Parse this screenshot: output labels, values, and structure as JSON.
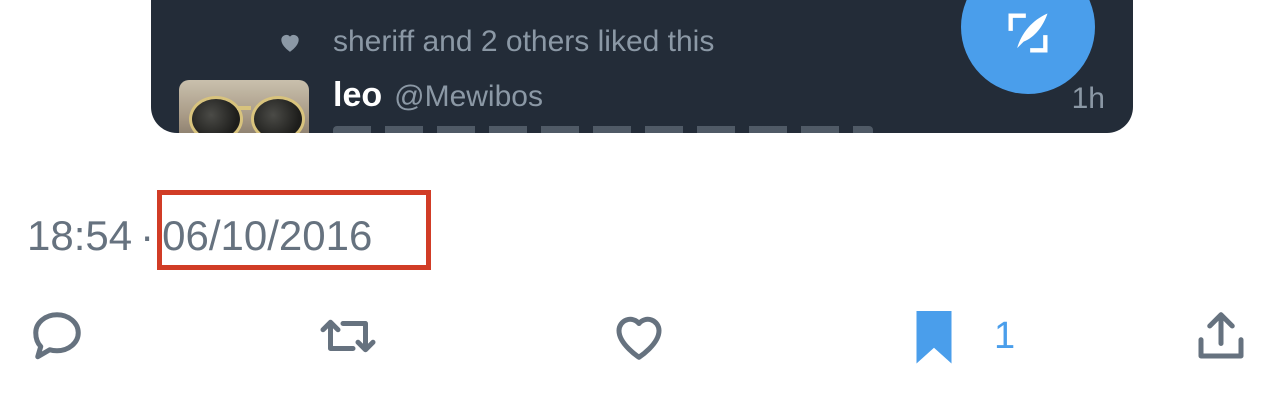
{
  "embedded_tweet": {
    "liked_by_text": "sheriff and 2 others liked this",
    "author_name": "leo",
    "author_handle": "@Mewibos",
    "time_ago": "1h",
    "avatar_icon": "sunglasses-avatar",
    "compose_icon": "feather-compose-icon"
  },
  "timestamp": {
    "time": "18:54",
    "separator": "·",
    "date": "06/10/2016"
  },
  "actions": {
    "reply_icon": "reply-icon",
    "retweet_icon": "retweet-icon",
    "like_icon": "heart-icon",
    "bookmark_icon": "bookmark-icon",
    "bookmark_count": "1",
    "share_icon": "share-icon"
  },
  "colors": {
    "embed_background": "#232c38",
    "accent": "#4a9eeb",
    "muted_text": "#66727f",
    "highlight_box": "#d13c26"
  }
}
